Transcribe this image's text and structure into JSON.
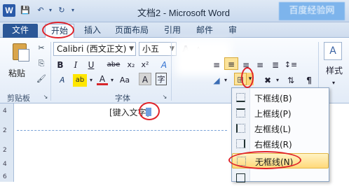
{
  "titlebar": {
    "app_icon": "W",
    "title": "文档2 - Microsoft Word",
    "right_blurred": "百度经验网"
  },
  "tabs": [
    {
      "label": "文件"
    },
    {
      "label": "开始"
    },
    {
      "label": "插入"
    },
    {
      "label": "页面布局"
    },
    {
      "label": "引用"
    },
    {
      "label": "邮件"
    },
    {
      "label": "审"
    }
  ],
  "clipboard": {
    "paste_label": "粘贴",
    "group_label": "剪贴板"
  },
  "font": {
    "font_name": "Calibri (西文正文)",
    "font_size": "小五",
    "group_label": "字体",
    "buttons": [
      "B",
      "I",
      "U",
      "abe",
      "x₂",
      "x²",
      "A",
      "A",
      "Aa"
    ]
  },
  "paragraph_style": {
    "style_label": "样式"
  },
  "document": {
    "header_text": "[键入文字]",
    "ruler_marks": [
      "4",
      "2",
      "2",
      "4",
      "6"
    ]
  },
  "border_menu": {
    "items": [
      {
        "label": "下框线(B)"
      },
      {
        "label": "上框线(P)"
      },
      {
        "label": "左框线(L)"
      },
      {
        "label": "右框线(R)"
      },
      {
        "label": "无框线(N)"
      }
    ]
  }
}
